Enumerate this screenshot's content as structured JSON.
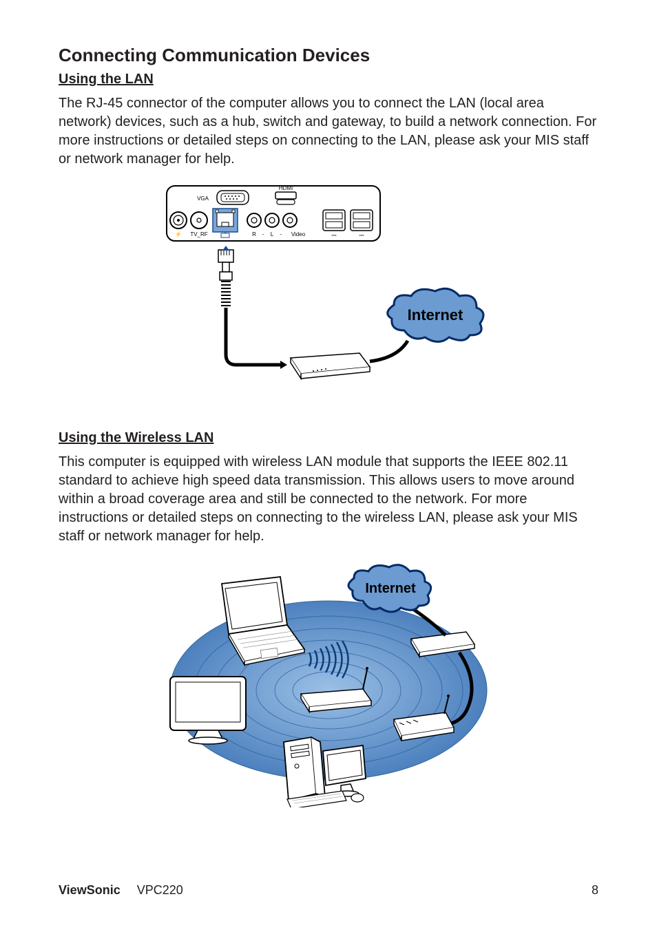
{
  "title": "Connecting Communication Devices",
  "section1": {
    "heading": "Using the LAN",
    "paragraph": "The RJ-45 connector of the computer allows you to connect the LAN (local area network) devices, such as a hub, switch and gateway, to build a network connection. For more instructions or detailed steps on connecting to the LAN, please ask your MIS staff or network manager for help."
  },
  "section2": {
    "heading": "Using the Wireless LAN",
    "paragraph": "This computer is equipped with wireless LAN module that supports the IEEE 802.11 standard to achieve high speed data transmission. This allows users to move around within a broad coverage area and still be connected to the network. For more instructions or detailed steps on connecting to the wireless LAN, please ask your MIS staff or network manager for help."
  },
  "diagram1": {
    "port_labels": {
      "vga": "VGA",
      "hdmi": "HDMI",
      "tvrf": "TV_RF",
      "r": "R",
      "l": "L",
      "video": "Video"
    },
    "cloud_label": "Internet"
  },
  "diagram2": {
    "cloud_label": "Internet"
  },
  "footer": {
    "brand": "ViewSonic",
    "model": "VPC220",
    "page": "8"
  }
}
